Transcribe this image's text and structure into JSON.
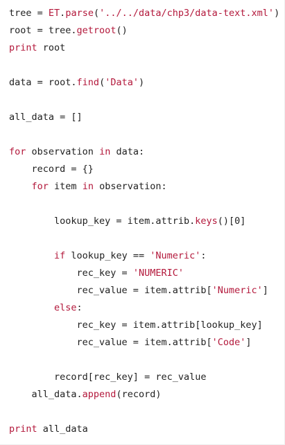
{
  "code": {
    "language": "python",
    "colors": {
      "plain": "#1f1f1f",
      "keyword": "#b3183b",
      "string": "#b3183b",
      "background": "#ffffff"
    },
    "lines": [
      [
        {
          "t": "tree = ",
          "k": "plain"
        },
        {
          "t": "ET",
          "k": "call"
        },
        {
          "t": ".",
          "k": "plain"
        },
        {
          "t": "parse",
          "k": "call"
        },
        {
          "t": "(",
          "k": "plain"
        },
        {
          "t": "'../../data/chp3/data-text.xml'",
          "k": "string"
        },
        {
          "t": ")",
          "k": "plain"
        }
      ],
      [
        {
          "t": "root = tree.",
          "k": "plain"
        },
        {
          "t": "getroot",
          "k": "call"
        },
        {
          "t": "()",
          "k": "plain"
        }
      ],
      [
        {
          "t": "print",
          "k": "keyword"
        },
        {
          "t": " root",
          "k": "plain"
        }
      ],
      [],
      [
        {
          "t": "data = root.",
          "k": "plain"
        },
        {
          "t": "find",
          "k": "call"
        },
        {
          "t": "(",
          "k": "plain"
        },
        {
          "t": "'Data'",
          "k": "string"
        },
        {
          "t": ")",
          "k": "plain"
        }
      ],
      [],
      [
        {
          "t": "all_data = []",
          "k": "plain"
        }
      ],
      [],
      [
        {
          "t": "for",
          "k": "keyword"
        },
        {
          "t": " observation ",
          "k": "plain"
        },
        {
          "t": "in",
          "k": "keyword"
        },
        {
          "t": " data:",
          "k": "plain"
        }
      ],
      [
        {
          "t": "    record = {}",
          "k": "plain"
        }
      ],
      [
        {
          "t": "    ",
          "k": "plain"
        },
        {
          "t": "for",
          "k": "keyword"
        },
        {
          "t": " item ",
          "k": "plain"
        },
        {
          "t": "in",
          "k": "keyword"
        },
        {
          "t": " observation:",
          "k": "plain"
        }
      ],
      [],
      [
        {
          "t": "        lookup_key = item.attrib.",
          "k": "plain"
        },
        {
          "t": "keys",
          "k": "call"
        },
        {
          "t": "()[0]",
          "k": "plain"
        }
      ],
      [],
      [
        {
          "t": "        ",
          "k": "plain"
        },
        {
          "t": "if",
          "k": "keyword"
        },
        {
          "t": " lookup_key == ",
          "k": "plain"
        },
        {
          "t": "'Numeric'",
          "k": "string"
        },
        {
          "t": ":",
          "k": "plain"
        }
      ],
      [
        {
          "t": "            rec_key = ",
          "k": "plain"
        },
        {
          "t": "'NUMERIC'",
          "k": "string"
        }
      ],
      [
        {
          "t": "            rec_value = item.attrib[",
          "k": "plain"
        },
        {
          "t": "'Numeric'",
          "k": "string"
        },
        {
          "t": "]",
          "k": "plain"
        }
      ],
      [
        {
          "t": "        ",
          "k": "plain"
        },
        {
          "t": "else",
          "k": "keyword"
        },
        {
          "t": ":",
          "k": "plain"
        }
      ],
      [
        {
          "t": "            rec_key = item.attrib[lookup_key]",
          "k": "plain"
        }
      ],
      [
        {
          "t": "            rec_value = item.attrib[",
          "k": "plain"
        },
        {
          "t": "'Code'",
          "k": "string"
        },
        {
          "t": "]",
          "k": "plain"
        }
      ],
      [],
      [
        {
          "t": "        record[rec_key] = rec_value",
          "k": "plain"
        }
      ],
      [
        {
          "t": "    all_data.",
          "k": "plain"
        },
        {
          "t": "append",
          "k": "call"
        },
        {
          "t": "(record)",
          "k": "plain"
        }
      ],
      [],
      [
        {
          "t": "print",
          "k": "keyword"
        },
        {
          "t": " all_data",
          "k": "plain"
        }
      ]
    ]
  }
}
